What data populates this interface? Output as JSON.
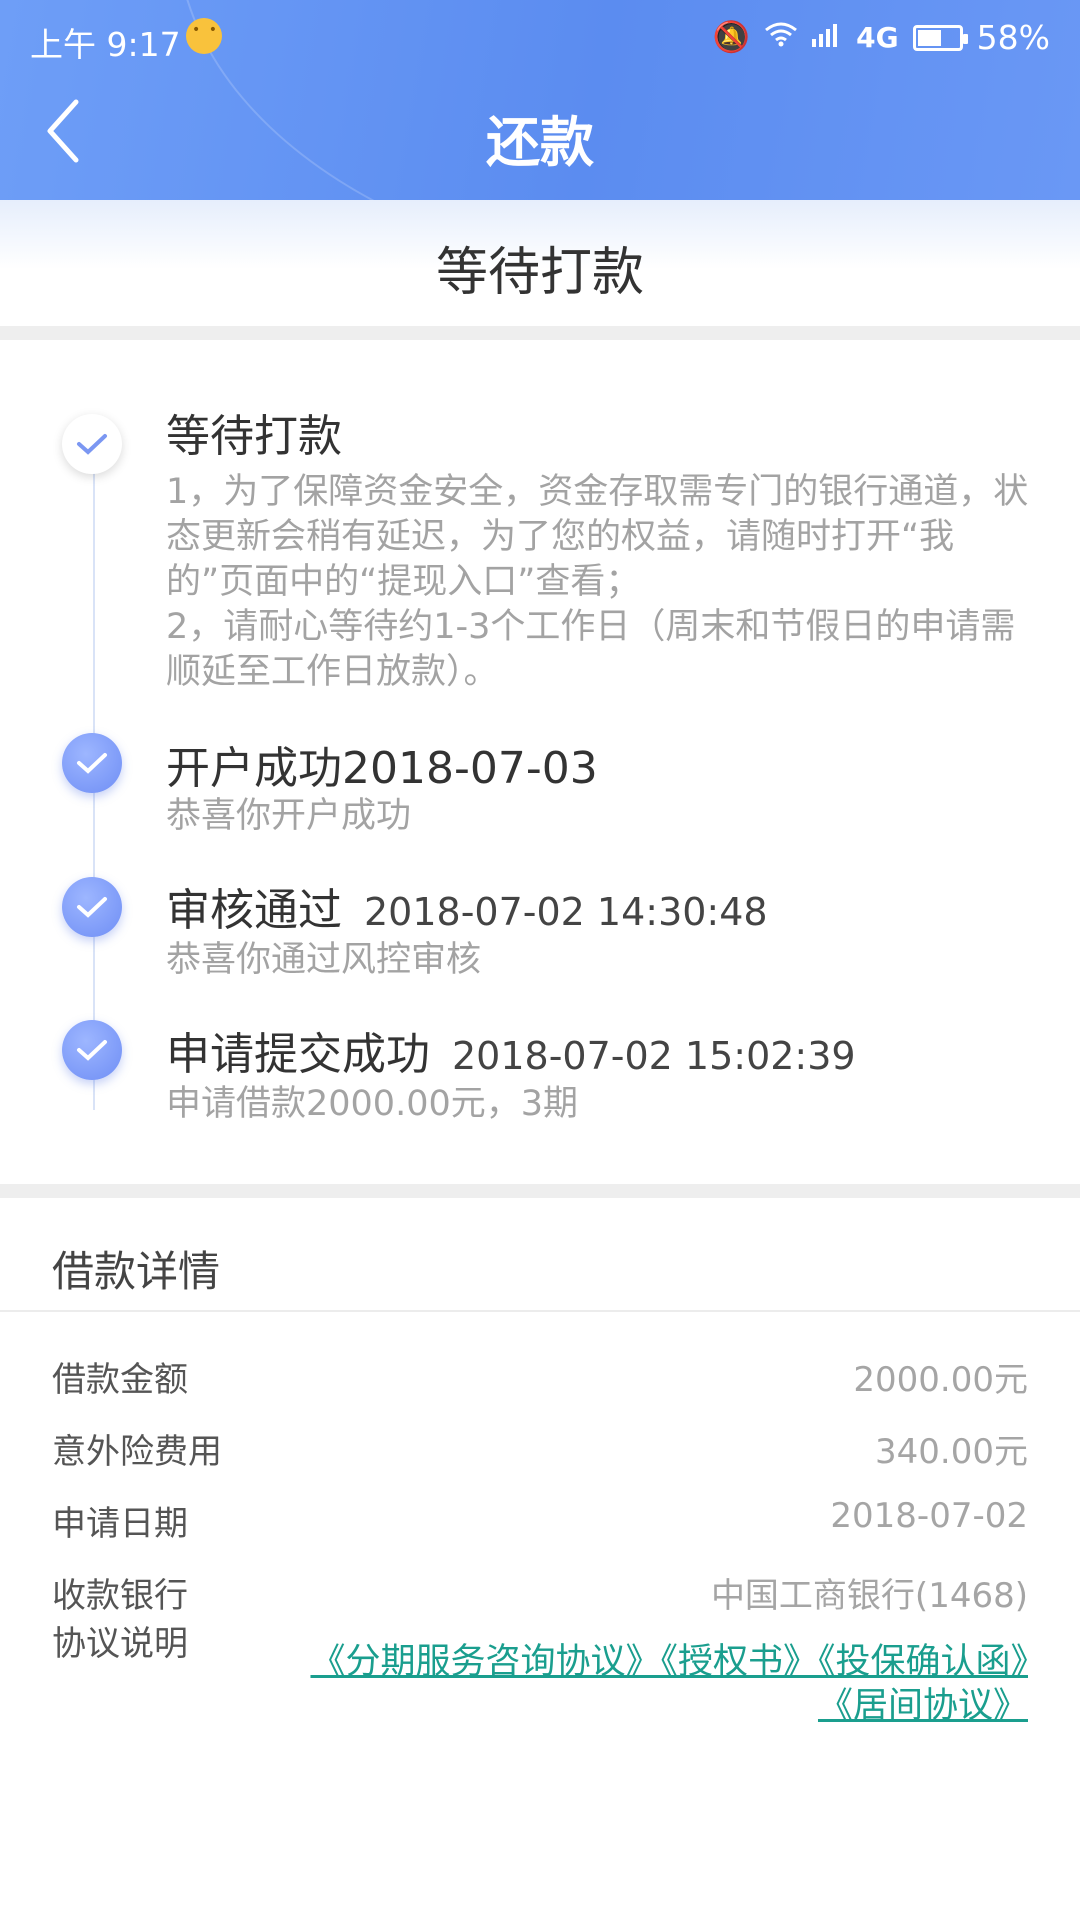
{
  "status_bar": {
    "time": "上午 9:17",
    "network": "4G",
    "battery": "58%",
    "battery_level": 0.58
  },
  "nav": {
    "title": "还款",
    "back_icon": "chevron-left-icon"
  },
  "status_header": "等待打款",
  "timeline": [
    {
      "title": "等待打款",
      "timestamp": "",
      "description": "1，为了保障资金安全，资金存取需专门的银行通道，状态更新会稍有延迟，为了您的权益，请随时打开“我的”页面中的“提现入口”查看；\n2，请耐心等待约1-3个工作日（周末和节假日的申请需顺延至工作日放款）。"
    },
    {
      "title": "开户成功2018-07-03",
      "timestamp": "",
      "description": "恭喜你开户成功"
    },
    {
      "title": "审核通过",
      "timestamp": "2018-07-02 14:30:48",
      "description": "恭喜你通过风控审核"
    },
    {
      "title": "申请提交成功",
      "timestamp": "2018-07-02 15:02:39",
      "description": "申请借款2000.00元，3期"
    }
  ],
  "loan_details": {
    "section_title": "借款详情",
    "rows": [
      {
        "label": "借款金额",
        "value": "2000.00元"
      },
      {
        "label": "意外险费用",
        "value": "340.00元"
      },
      {
        "label": "申请日期",
        "value": "2018-07-02"
      },
      {
        "label": "收款银行",
        "value": "中国工商银行(1468)"
      }
    ],
    "agreement_label": "协议说明",
    "agreement_links": "《分期服务咨询协议》《授权书》《投保确认函》《居间协议》"
  },
  "colors": {
    "header_blue": "#5b8cf0",
    "link_teal": "#1a9e8e",
    "check_blue": "#7b97f2"
  }
}
